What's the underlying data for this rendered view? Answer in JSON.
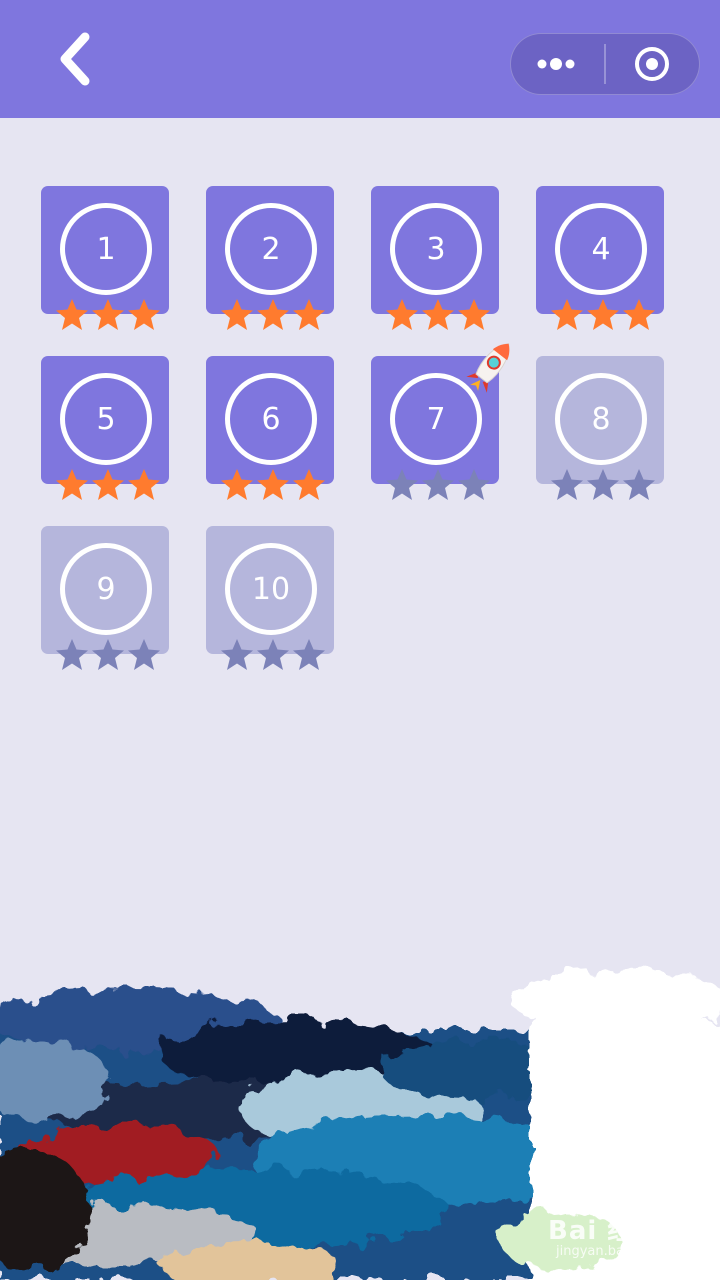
{
  "colors": {
    "topbar": "#7f76de",
    "background": "#e6e5f2",
    "tile_unlocked": "#7f76de",
    "tile_locked": "#b5b6dc",
    "star_earned": "#ff7b2e",
    "star_empty": "#7c82b8"
  },
  "topbar": {
    "back_icon": "chevron-left-icon",
    "menu_icon": "more-dots-icon",
    "close_icon": "target-circle-icon"
  },
  "levels": [
    {
      "label": "1",
      "status": "unlocked",
      "stars": 3
    },
    {
      "label": "2",
      "status": "unlocked",
      "stars": 3
    },
    {
      "label": "3",
      "status": "unlocked",
      "stars": 3
    },
    {
      "label": "4",
      "status": "unlocked",
      "stars": 3
    },
    {
      "label": "5",
      "status": "unlocked",
      "stars": 3
    },
    {
      "label": "6",
      "status": "unlocked",
      "stars": 3
    },
    {
      "label": "7",
      "status": "current",
      "stars": 0
    },
    {
      "label": "8",
      "status": "locked",
      "stars": 0
    },
    {
      "label": "9",
      "status": "locked",
      "stars": 0
    },
    {
      "label": "10",
      "status": "locked",
      "stars": 0
    }
  ],
  "current_marker_icon": "rocket-icon",
  "watermark": {
    "text": "Bai 经验",
    "sub": "jingyan.baidu.com"
  }
}
